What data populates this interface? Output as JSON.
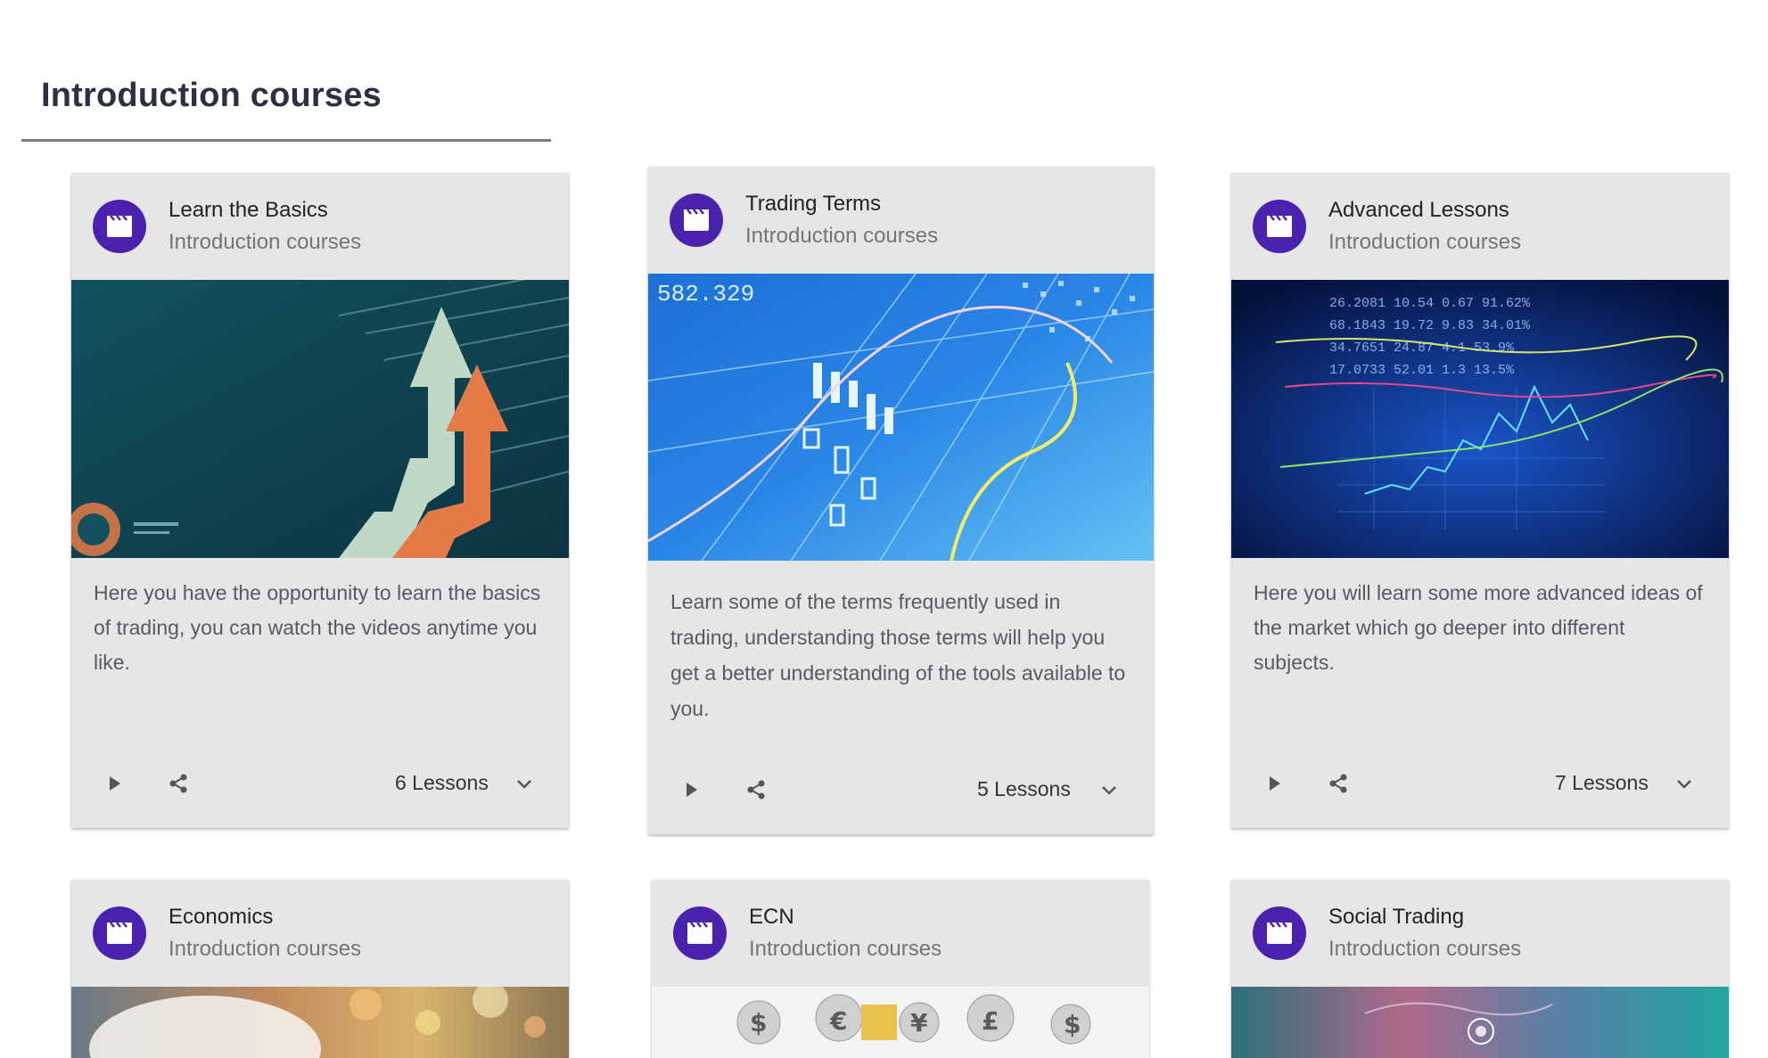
{
  "section": {
    "title": "Introduction courses"
  },
  "cards": [
    {
      "title": "Learn the Basics",
      "subtitle": "Introduction courses",
      "description": "Here you have the opportunity to learn the basics of trading, you can watch the videos anytime you like.",
      "lessons": "6 Lessons",
      "image": "rising-arrows-chart"
    },
    {
      "title": "Trading Terms",
      "subtitle": "Introduction courses",
      "description": "Learn some of the terms frequently used in trading, understanding those terms will help you get a better understanding of the tools available to you.",
      "lessons": "5 Lessons",
      "image": "blue-candlestick-chart"
    },
    {
      "title": "Advanced Lessons",
      "subtitle": "Introduction courses",
      "description": "Here you will learn some more advanced ideas of the market which go deeper into different subjects.",
      "lessons": "7 Lessons",
      "image": "stock-ticker-screen"
    },
    {
      "title": "Economics",
      "subtitle": "Introduction courses",
      "image": "bokeh-lights"
    },
    {
      "title": "ECN",
      "subtitle": "Introduction courses",
      "image": "currency-symbols"
    },
    {
      "title": "Social Trading",
      "subtitle": "Introduction courses",
      "image": "world-map-network"
    }
  ],
  "icons": {
    "avatar": "movie-clapper-icon",
    "play": "play-icon",
    "share": "share-icon",
    "expand": "chevron-down-icon"
  },
  "colors": {
    "accent": "#4b22ad",
    "card_background": "#e6e6e6",
    "title_text": "#2b3140"
  }
}
